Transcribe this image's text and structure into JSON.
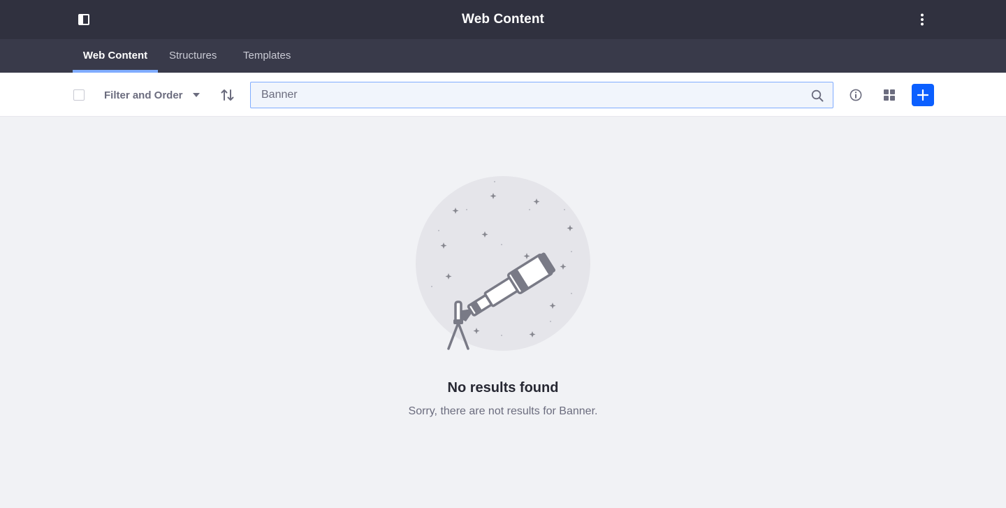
{
  "header": {
    "title": "Web Content"
  },
  "tabs": [
    {
      "label": "Web Content",
      "active": true
    },
    {
      "label": "Structures",
      "active": false
    },
    {
      "label": "Templates",
      "active": false
    }
  ],
  "toolbar": {
    "filter_label": "Filter and Order",
    "search": {
      "value": "Banner",
      "placeholder": ""
    }
  },
  "empty_state": {
    "title": "No results found",
    "description": "Sorry, there are not results for Banner."
  },
  "icons": {
    "sidebar_toggle": "sidebar-toggle-icon",
    "kebab": "vertical-ellipsis-icon",
    "sort": "sort-order-icon",
    "search": "search-icon",
    "info": "info-circle-icon",
    "display": "cards-grid-icon",
    "add": "plus-icon",
    "illustration": "telescope-illustration"
  },
  "colors": {
    "header_bg": "#30313f",
    "nav_bg": "#393a4a",
    "active_tab_indicator": "#80acff",
    "primary": "#0b5fff",
    "page_bg": "#f1f2f5"
  }
}
